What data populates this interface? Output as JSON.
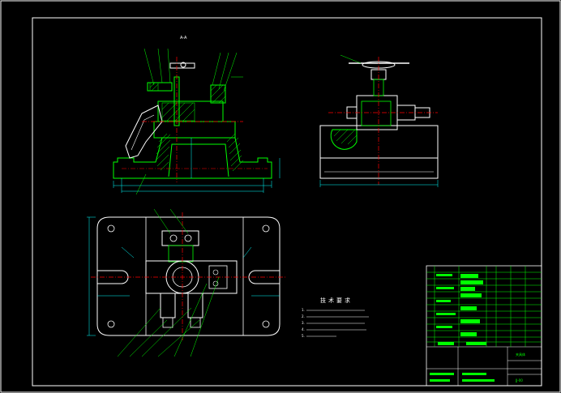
{
  "views": {
    "section_label": "A-A"
  },
  "technical_requirements": {
    "title": "技术要求",
    "notes": [
      "1.",
      "2.",
      "3.",
      "4.",
      "5."
    ]
  },
  "title_block": {
    "drawing_name": "夹具体",
    "drawing_number": "JJ-00"
  },
  "colors": {
    "background": "#000000",
    "outline": "#ffffff",
    "geometry": "#00ff00",
    "dimension": "#00ffff",
    "centerline": "#ff0000",
    "hatch": "#00ff00"
  }
}
